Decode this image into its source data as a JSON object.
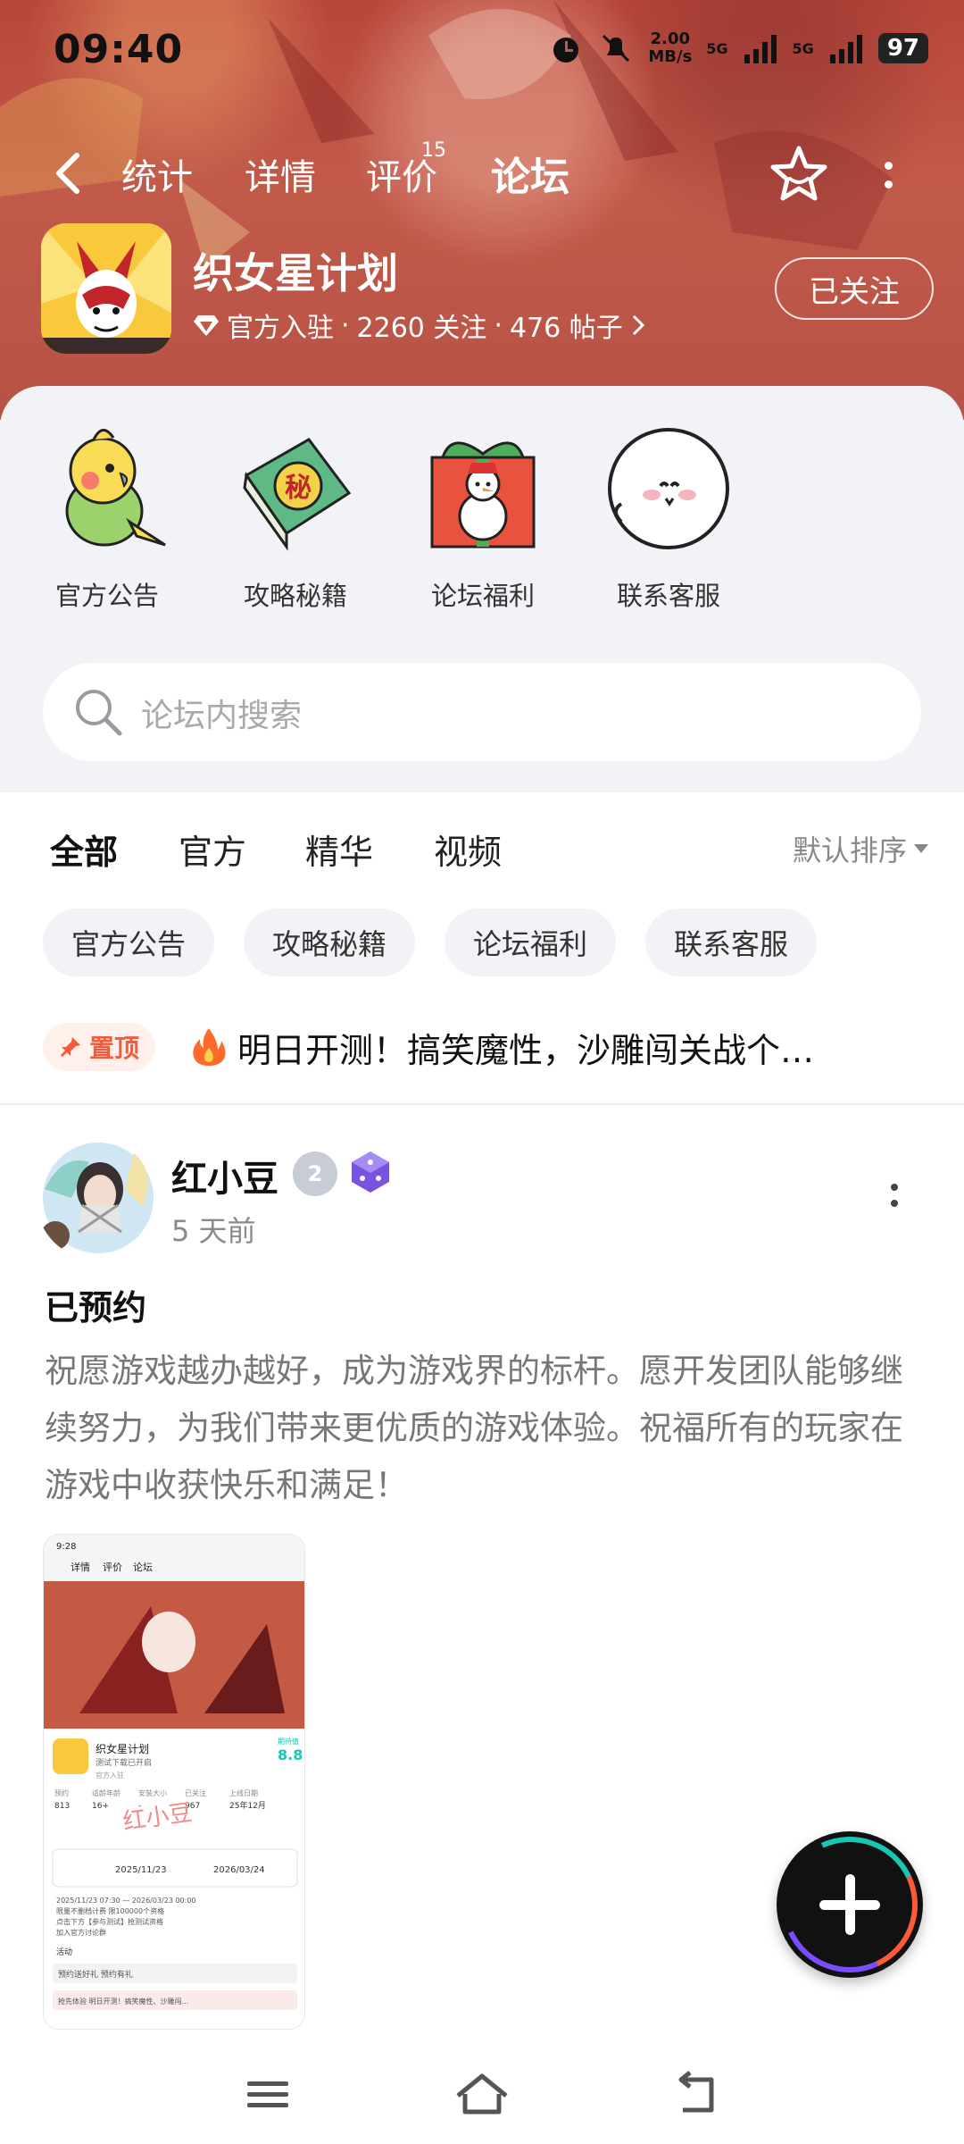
{
  "status_bar": {
    "time": "09:40",
    "speed_value": "2.00",
    "speed_unit": "MB/s",
    "signal1": "5G",
    "signal2": "5G",
    "battery": "97"
  },
  "top_nav": {
    "tabs": [
      {
        "label": "统计"
      },
      {
        "label": "详情"
      },
      {
        "label": "评价",
        "badge": "15"
      },
      {
        "label": "论坛",
        "active": true
      }
    ]
  },
  "game": {
    "title": "织女星计划",
    "official": "官方入驻",
    "followers": "2260 关注",
    "posts": "476 帖子",
    "follow_button": "已关注"
  },
  "shortcuts": [
    {
      "label": "官方公告",
      "icon": "parrot-icon"
    },
    {
      "label": "攻略秘籍",
      "icon": "secret-book-icon"
    },
    {
      "label": "论坛福利",
      "icon": "gift-snowman-icon"
    },
    {
      "label": "联系客服",
      "icon": "ghost-face-icon"
    }
  ],
  "search": {
    "placeholder": "论坛内搜索"
  },
  "filter_tabs": {
    "tabs": [
      "全部",
      "官方",
      "精华",
      "视频"
    ],
    "active": "全部",
    "sort_label": "默认排序"
  },
  "chips": [
    "官方公告",
    "攻略秘籍",
    "论坛福利",
    "联系客服"
  ],
  "pinned": {
    "badge": "置顶",
    "title": "明日开测！搞笑魔性，沙雕闯关战个…"
  },
  "post": {
    "username": "红小豆",
    "level_badge": "2",
    "time": "5 天前",
    "title": "已预约",
    "body": "祝愿游戏越办越好，成为游戏界的标杆。愿开发团队能够继续努力，为我们带来更优质的游戏体验。祝福所有的玩家在游戏中收获快乐和满足！",
    "thumbnail": {
      "status_time": "9:28",
      "tabs": [
        "详情",
        "评价",
        "论坛"
      ],
      "game_title": "织女星计划",
      "sub_line": "测试下载已开启",
      "official": "官方入驻",
      "rating_label": "期待值",
      "rating": "8.8",
      "stats_labels": [
        "预约",
        "适龄年龄",
        "安装大小",
        "已关注",
        "上线日期"
      ],
      "stats_values": [
        "813",
        "16+",
        "-",
        "967",
        "25年12月"
      ],
      "watermark": "红小豆",
      "date_start": "2025/11/23",
      "date_end": "2026/03/24",
      "info_lines": [
        "2025/11/23 07:30 — 2026/03/23 00:00",
        "限量不删档计费 限100000个资格",
        "点击下方【参与测试】抢测试资格",
        "加入官方讨论群"
      ],
      "activity_label": "活动",
      "activity_line": "预约送好礼 预约有礼",
      "bottom_line": "抢先体验 明日开测！搞笑魔性、沙雕闯..."
    }
  },
  "colors": {
    "accent": "#17c7b3",
    "banner": "#b8463a",
    "pin": "#f25b3c"
  }
}
